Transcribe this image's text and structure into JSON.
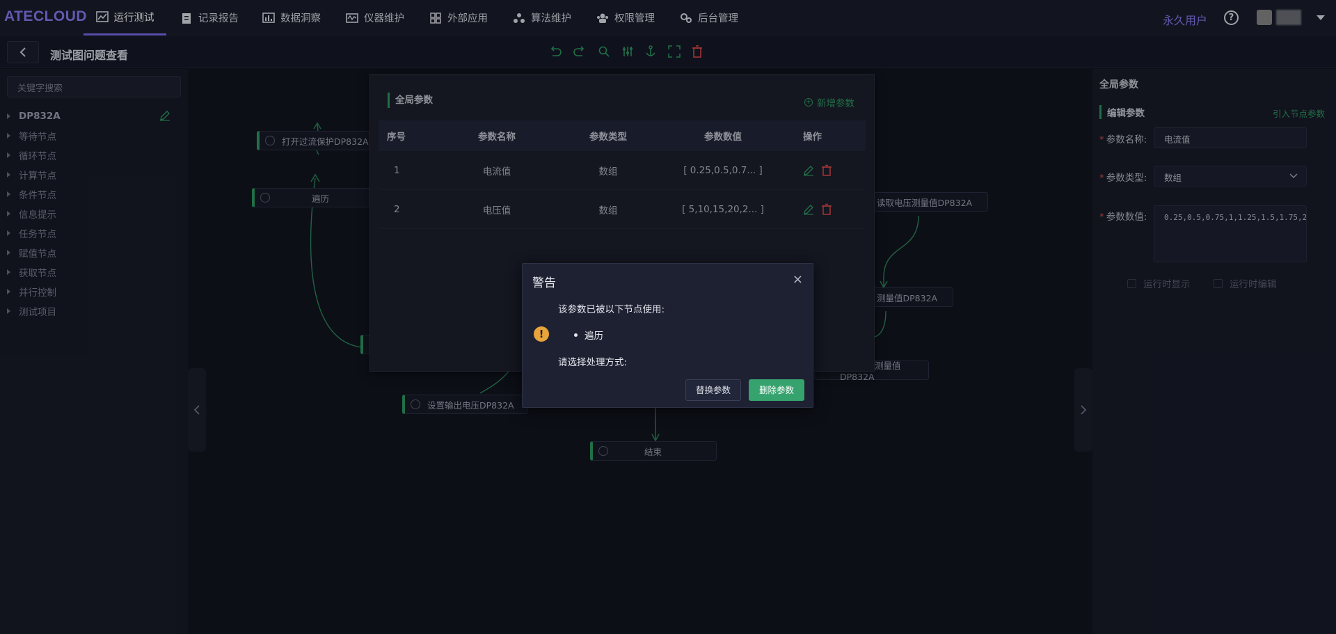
{
  "app": {
    "logo": "ATECLOUD"
  },
  "nav": {
    "items": [
      {
        "label": "运行测试",
        "icon": "chart-line-icon",
        "active": true
      },
      {
        "label": "记录报告",
        "icon": "clipboard-icon"
      },
      {
        "label": "数据洞察",
        "icon": "bar-chart-icon"
      },
      {
        "label": "仪器维护",
        "icon": "instrument-icon"
      },
      {
        "label": "外部应用",
        "icon": "grid-icon"
      },
      {
        "label": "算法维护",
        "icon": "algorithm-icon"
      },
      {
        "label": "权限管理",
        "icon": "users-icon"
      },
      {
        "label": "后台管理",
        "icon": "gears-icon"
      }
    ],
    "user": "永久用户",
    "help": "?"
  },
  "subheader": {
    "title": "测试图问题查看"
  },
  "sidebar": {
    "search_placeholder": "关键字搜索",
    "items": [
      "DP832A",
      "等待节点",
      "循环节点",
      "计算节点",
      "条件节点",
      "信息提示",
      "任务节点",
      "赋值节点",
      "获取节点",
      "并行控制",
      "测试项目"
    ]
  },
  "canvas": {
    "nodes": [
      {
        "label": "打开过流保护DP832A"
      },
      {
        "label": "遍历"
      },
      {
        "label": "读取电压测量值DP832A"
      },
      {
        "label": "测量值DP832A"
      },
      {
        "label": "读取电压测量值DP832A"
      },
      {
        "label": "设置输出电压DP832A"
      },
      {
        "label": "结束"
      }
    ]
  },
  "global_params": {
    "title": "全局参数",
    "add_label": "新增参数",
    "columns": [
      "序号",
      "参数名称",
      "参数类型",
      "参数数值",
      "操作"
    ],
    "rows": [
      {
        "index": "1",
        "name": "电流值",
        "type": "数组",
        "value": "[ 0.25,0.5,0.7... ]"
      },
      {
        "index": "2",
        "name": "电压值",
        "type": "数组",
        "value": "[ 5,10,15,20,2... ]"
      }
    ]
  },
  "right_panel": {
    "title": "全局参数",
    "section_title": "编辑参数",
    "import_link": "引入节点参数",
    "name_label": "参数名称:",
    "name_value": "电流值",
    "type_label": "参数类型:",
    "type_value": "数组",
    "value_label": "参数数值:",
    "value_text": "0.25,0.5,0.75,1,1.25,1.5,1.75,2",
    "check_show": "运行时显示",
    "check_edit": "运行时编辑"
  },
  "warning_dialog": {
    "title": "警告",
    "close": "×",
    "line1": "该参数已被以下节点使用:",
    "used_nodes": [
      "遍历"
    ],
    "line2": "请选择处理方式:",
    "replace_button": "替换参数",
    "delete_button": "删除参数",
    "icon": "!"
  },
  "colors": {
    "accent": "#7a6cf0",
    "green": "#2e9a62",
    "danger": "#e04b4b",
    "warning": "#e8a33b"
  }
}
